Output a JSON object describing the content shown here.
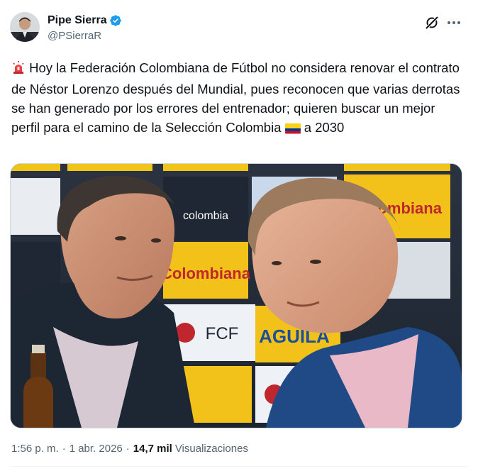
{
  "author": {
    "name": "Pipe Sierra",
    "handle": "@PSierraR",
    "verified": true,
    "accent_color": "#1d9bf0"
  },
  "header_actions": {
    "grok_icon": "grok-icon",
    "more_icon": "more-icon"
  },
  "tweet": {
    "siren_emoji": "🚨",
    "text_part1": " Hoy la Federación Colombiana de Fútbol no considera renovar el contrato de Néstor Lorenzo después del Mundial, pues reconocen que varias derrotas se han generado por los errores del entrenador; quieren buscar un mejor perfil para el camino de la Selección Colombia ",
    "flag_emoji": "🇨🇴",
    "text_part2": " a 2030"
  },
  "media": {
    "sponsor_logo_1": "colombia",
    "sponsor_logo_2": "Colombiana",
    "sponsor_logo_3": "FCF",
    "sponsor_logo_4": "AGUILA"
  },
  "meta": {
    "time": "1:56 p. m.",
    "separator": "·",
    "date": "1 abr. 2026",
    "views_count": "14,7 mil",
    "views_label": "Visualizaciones"
  }
}
